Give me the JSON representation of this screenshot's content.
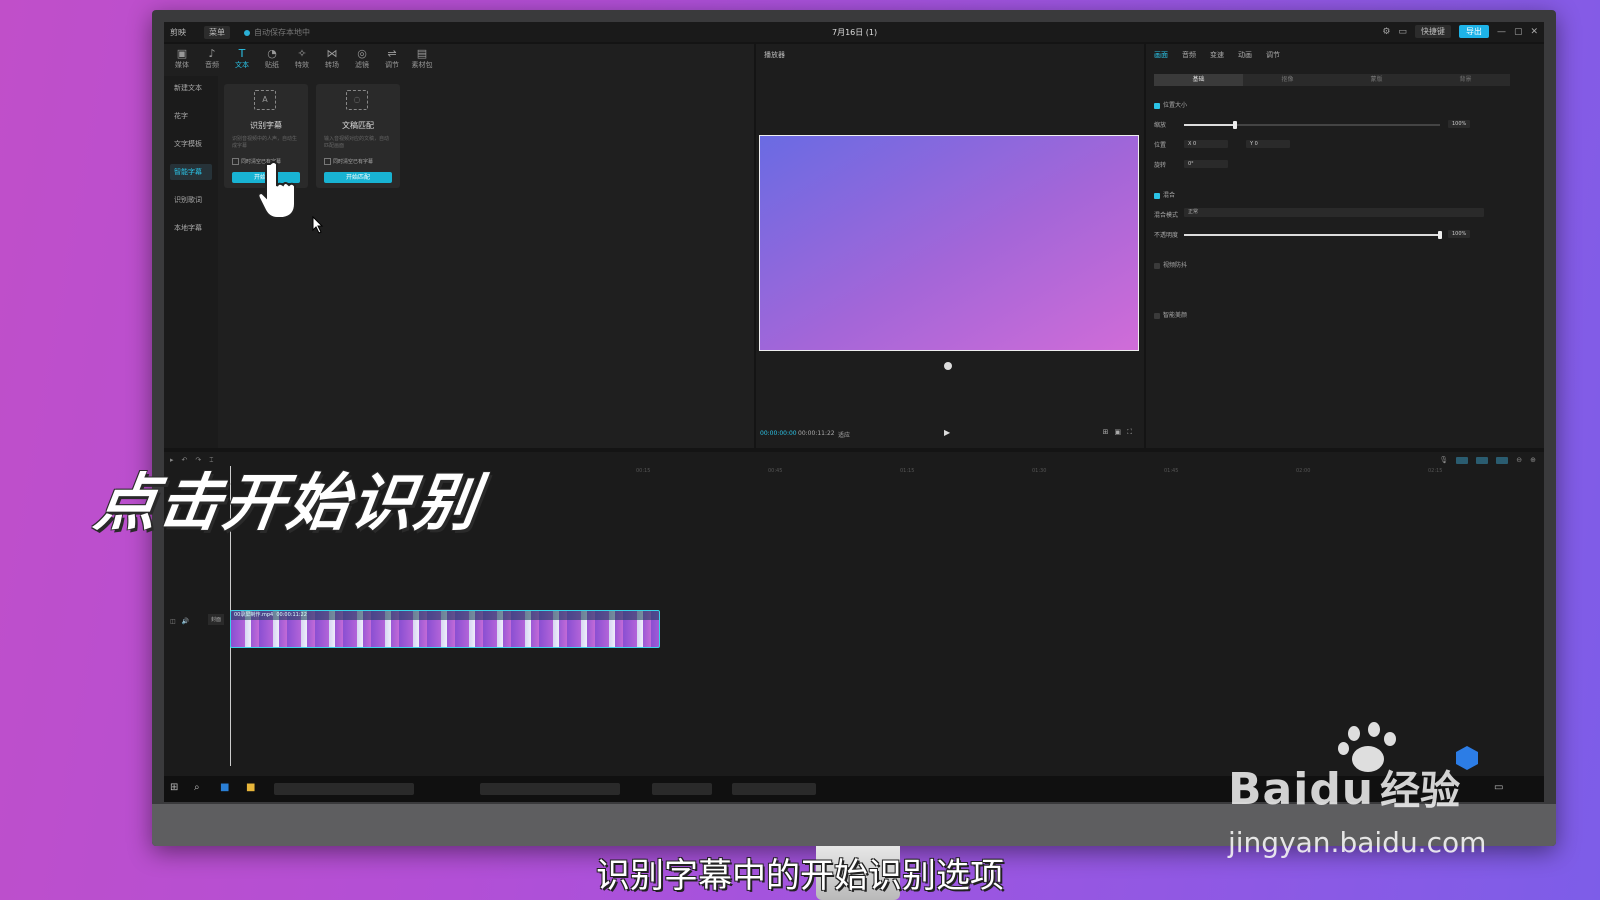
{
  "app": {
    "logo": "剪映",
    "menu": "菜单",
    "autosave": "自动保存本地中",
    "project_title": "7月16日 (1)",
    "shortcut": "快捷键",
    "export": "导出"
  },
  "toolbar": [
    {
      "icon": "▣",
      "label": "媒体"
    },
    {
      "icon": "♪",
      "label": "音频"
    },
    {
      "icon": "T",
      "label": "文本"
    },
    {
      "icon": "◔",
      "label": "贴纸"
    },
    {
      "icon": "✧",
      "label": "特效"
    },
    {
      "icon": "⋈",
      "label": "转场"
    },
    {
      "icon": "◎",
      "label": "滤镜"
    },
    {
      "icon": "⇌",
      "label": "调节"
    },
    {
      "icon": "▤",
      "label": "素材包"
    }
  ],
  "sidebar": [
    "新建文本",
    "花字",
    "文字模板",
    "智能字幕",
    "识别歌词",
    "本地字幕"
  ],
  "cards": [
    {
      "title": "识别字幕",
      "desc": "识别音视频中的人声，自动生成字幕",
      "check": "同时清空已有字幕",
      "button": "开始识别"
    },
    {
      "title": "文稿匹配",
      "desc": "输入音视频对应的文稿，自动匹配画面",
      "check": "同时清空已有字幕",
      "button": "开始匹配"
    }
  ],
  "player": {
    "title": "播放器",
    "time_current": "00:00:00:00",
    "time_total": "00:00:11:22",
    "ratio": "适应"
  },
  "inspector": {
    "tabs": [
      "画面",
      "音频",
      "变速",
      "动画",
      "调节"
    ],
    "subtabs": [
      "基础",
      "抠像",
      "蒙版",
      "背景"
    ],
    "position_size": "位置大小",
    "scale_label": "缩放",
    "scale_value": "100%",
    "position_label": "位置",
    "x_label": "X",
    "x_value": "0",
    "y_label": "Y",
    "y_value": "0",
    "rotation_label": "旋转",
    "rotation_value": "0°",
    "blend": "混合",
    "blend_mode_label": "混合模式",
    "blend_mode_value": "正常",
    "opacity_label": "不透明度",
    "opacity_value": "100%",
    "stabilize": "视频防抖",
    "beauty": "智能美颜",
    "scale_fraction": 0.2,
    "opacity_fraction": 1.0
  },
  "timeline": {
    "ticks": [
      "00:15",
      "00:45",
      "01:15",
      "01:30",
      "01:45",
      "02:00",
      "02:15"
    ],
    "cover_label": "封面",
    "clip_name": "00录屏制作.mp4",
    "clip_duration": "00:00:11:22"
  },
  "overlay": {
    "title": "点击开始识别",
    "caption": "识别字幕中的开始识别选项"
  },
  "watermark": {
    "brand": "Bai",
    "brand2": "du",
    "product": "经验",
    "url": "jingyan.baidu.com"
  },
  "colors": {
    "accent": "#2bc3e6",
    "export": "#1db3e8",
    "button": "#18b3d3"
  }
}
